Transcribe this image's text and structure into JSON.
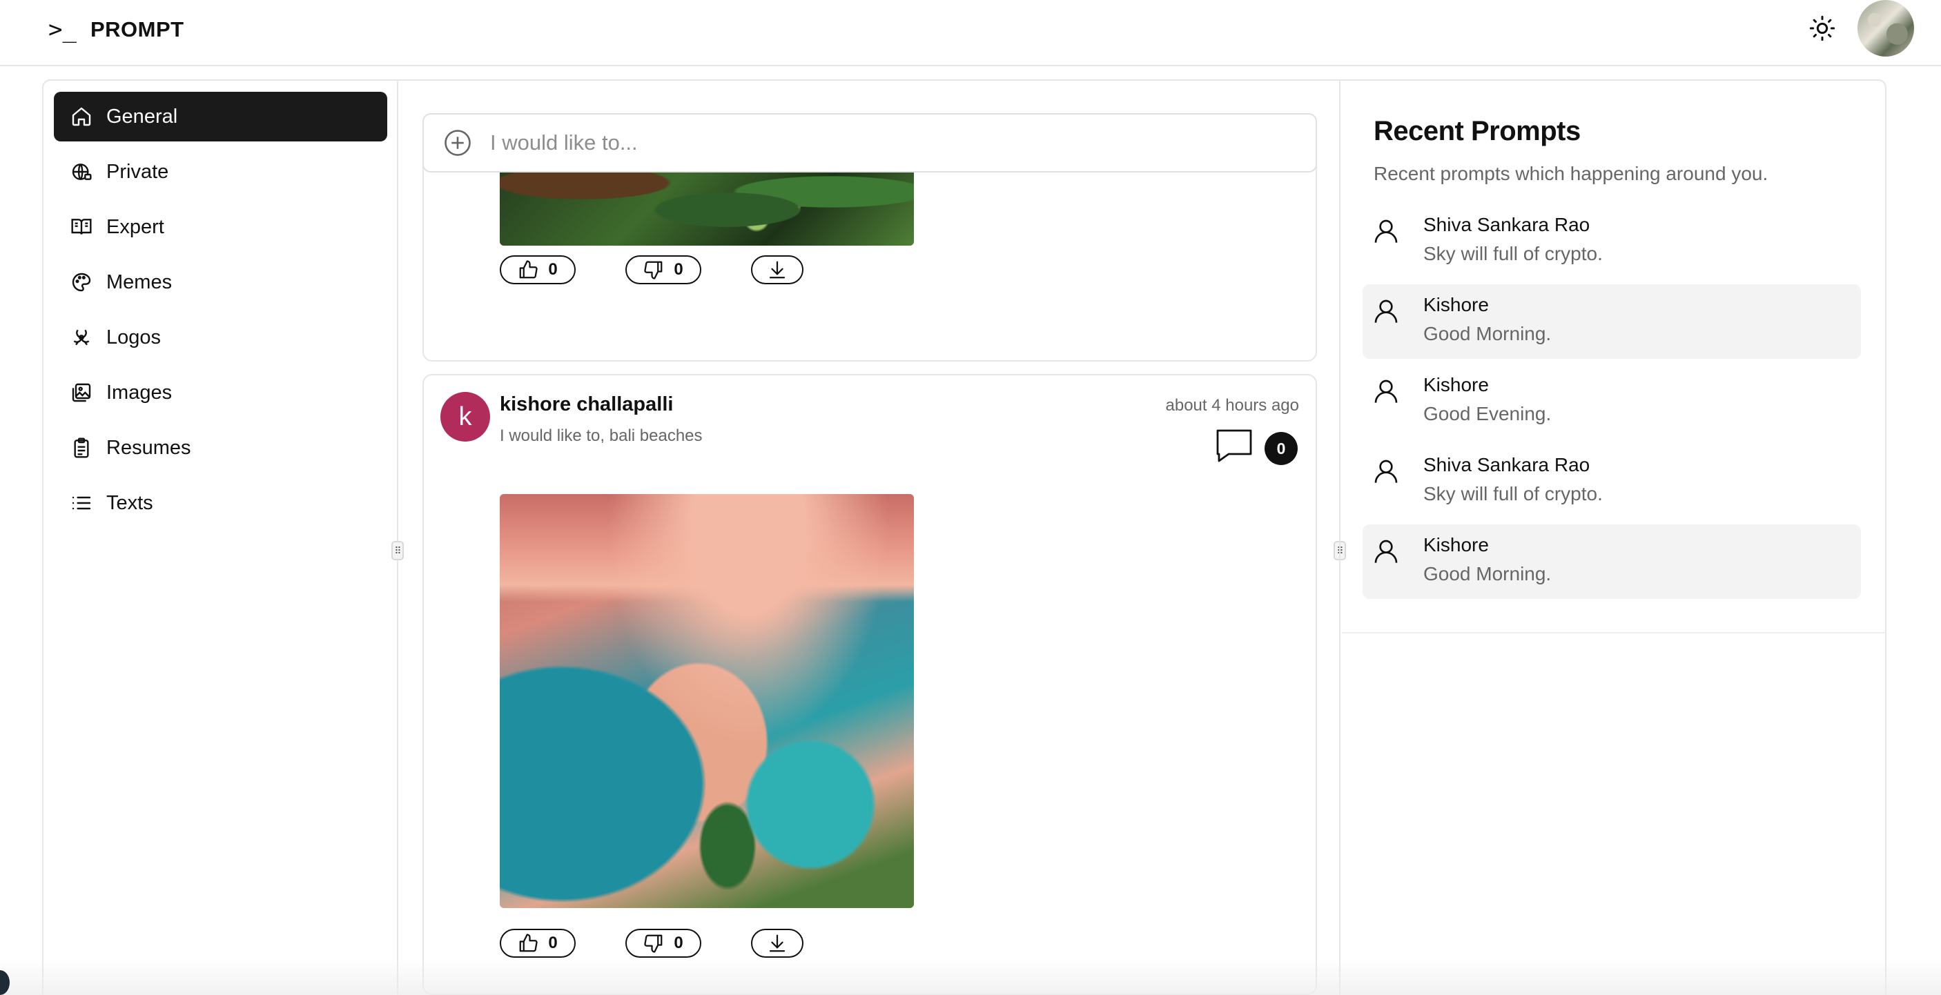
{
  "app": {
    "glyph": ">_",
    "name": "PROMPT"
  },
  "header": {
    "theme_icon": "sun-icon",
    "avatar": "user-avatar"
  },
  "sidebar": {
    "items": [
      {
        "label": "General",
        "icon": "home-icon",
        "active": true
      },
      {
        "label": "Private",
        "icon": "globe-lock-icon",
        "active": false
      },
      {
        "label": "Expert",
        "icon": "book-open-icon",
        "active": false
      },
      {
        "label": "Memes",
        "icon": "palette-icon",
        "active": false
      },
      {
        "label": "Logos",
        "icon": "biohazard-icon",
        "active": false
      },
      {
        "label": "Images",
        "icon": "images-icon",
        "active": false
      },
      {
        "label": "Resumes",
        "icon": "clipboard-icon",
        "active": false
      },
      {
        "label": "Texts",
        "icon": "list-icon",
        "active": false
      }
    ]
  },
  "composer": {
    "placeholder": "I would like to..."
  },
  "posts": [
    {
      "image": "coffee plants",
      "likes": "0",
      "dislikes": "0"
    },
    {
      "avatar_letter": "k",
      "author": "kishore challapalli",
      "prompt": "I would like to, bali beaches",
      "time": "about 4 hours ago",
      "comments": "0",
      "image": "bali beach aerial",
      "likes": "0",
      "dislikes": "0"
    }
  ],
  "recent": {
    "title": "Recent Prompts",
    "subtitle": "Recent prompts which happening around you.",
    "items": [
      {
        "name": "Shiva Sankara Rao",
        "text": "Sky will full of crypto.",
        "highlighted": false
      },
      {
        "name": "Kishore",
        "text": "Good Morning.",
        "highlighted": true
      },
      {
        "name": "Kishore",
        "text": "Good Evening.",
        "highlighted": false
      },
      {
        "name": "Shiva Sankara Rao",
        "text": "Sky will full of crypto.",
        "highlighted": false
      },
      {
        "name": "Kishore",
        "text": "Good Morning.",
        "highlighted": true
      }
    ]
  },
  "colors": {
    "active_nav": "#1a1a1a",
    "avatar_bg": "#b12c5b",
    "highlight": "#f3f3f3"
  }
}
